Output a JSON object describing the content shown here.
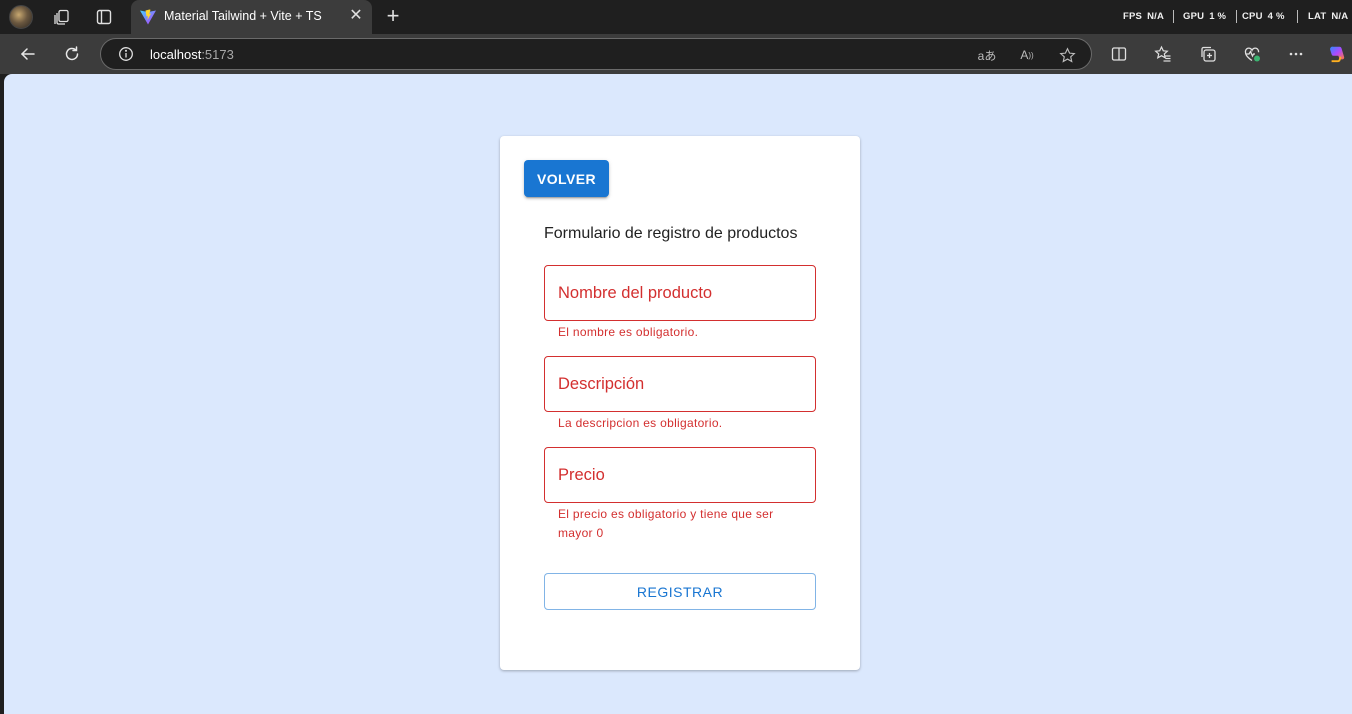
{
  "browser": {
    "tab": {
      "title": "Material Tailwind + Vite + TS"
    },
    "performance": {
      "fps_label": "FPS",
      "fps_value": "N/A",
      "gpu_label": "GPU",
      "gpu_value": "1 %",
      "cpu_label": "CPU",
      "cpu_value": "4 %",
      "lat_label": "LAT",
      "lat_value": "N/A"
    },
    "address": {
      "host": "localhost",
      "port": ":5173"
    },
    "icons": [
      "profile-avatar",
      "workspaces-icon",
      "tab-actions-icon",
      "vite-favicon",
      "close-icon",
      "plus-icon",
      "back-arrow-icon",
      "refresh-icon",
      "info-icon",
      "translate-icon",
      "read-aloud-icon",
      "favorite-star-icon",
      "split-screen-icon",
      "favorites-icon",
      "collections-icon",
      "browser-essentials-icon",
      "more-icon",
      "copilot-icon"
    ]
  },
  "page": {
    "back_button": "VOLVER",
    "form_title": "Formulario de registro de productos",
    "fields": [
      {
        "placeholder": "Nombre del producto",
        "error": "El nombre es obligatorio."
      },
      {
        "placeholder": "Descripción",
        "error": "La descripcion es obligatorio."
      },
      {
        "placeholder": "Precio",
        "error": "El precio es obligatorio y tiene que ser mayor 0"
      }
    ],
    "submit_button": "REGISTRAR"
  },
  "colors": {
    "page_background": "#dbe8fd",
    "primary": "#1976d2",
    "error": "#d32f2f",
    "browser_chrome": "#1f1f1f",
    "toolbar": "#3c3c3c"
  }
}
